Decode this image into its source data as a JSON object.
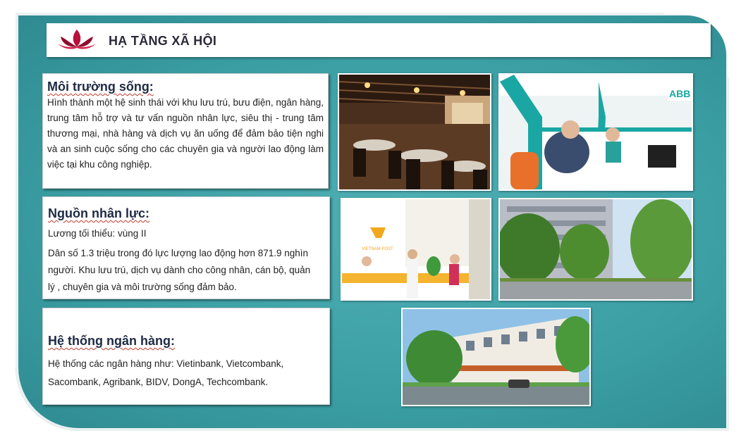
{
  "header": {
    "title": "HẠ TẦNG XÃ HỘI",
    "logo_icon": "lotus-icon"
  },
  "sections": {
    "living": {
      "heading": "Môi trường sống:",
      "body": "Hình thành một hệ sinh thái với khu lưu trú, bưu điện, ngân hàng, trung tâm hỗ trợ và tư vấn nguồn nhân lực, siêu thị - trung tâm thương mại, nhà hàng và dịch vụ ăn uống để đảm bảo tiện nghi và an sinh cuộc sống cho các chuyên gia và người lao động làm việc tại khu công nghiệp."
    },
    "labor": {
      "heading": "Nguồn nhân lực:",
      "line1": "Lương tối thiểu: vùng II",
      "line2": "Dân số 1.3 triệu trong đó lực lượng lao động hơn 871.9 nghìn người. Khu lưu trú, dịch vụ dành cho công nhân, cán bộ, quản lý , chuyên gia và môi trường sống đảm bảo."
    },
    "banking": {
      "heading": "Hệ thống ngân hàng:",
      "body": "Hệ thống các ngân hàng như: Vietinbank, Vietcombank, Sacombank, Agribank, BIDV, DongA, Techcombank."
    }
  },
  "photos": {
    "restaurant": "restaurant-photo",
    "bank_counter": "bank-counter-photo",
    "post_office": "post-office-photo",
    "dormitory": "dormitory-photo",
    "shophouse": "shophouse-photo",
    "post_sign": "VIETNAM POST",
    "bank_sign": "ABB"
  },
  "colors": {
    "background": "#3a9ea3",
    "heading": "#1e2a44",
    "lotus": "#b8103a"
  }
}
